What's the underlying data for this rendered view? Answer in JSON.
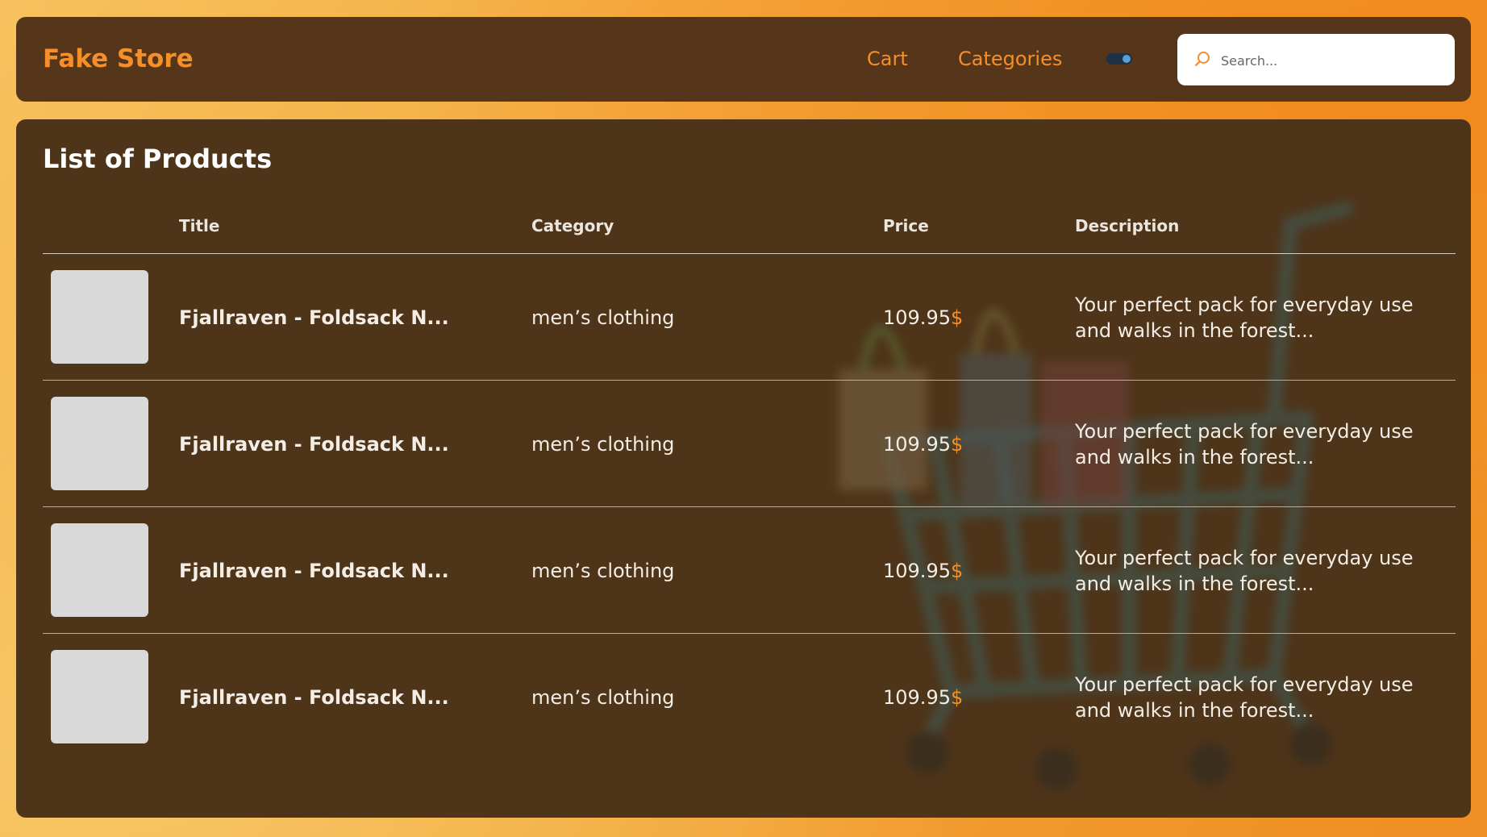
{
  "header": {
    "brand": "Fake Store",
    "nav": {
      "cart": "Cart",
      "categories": "Categories"
    },
    "search": {
      "placeholder": "Search...",
      "value": ""
    }
  },
  "main": {
    "title": "List of Products",
    "columns": {
      "title": "Title",
      "category": "Category",
      "price": "Price",
      "description": "Description"
    },
    "rows": [
      {
        "title": "Fjallraven - Foldsack N...",
        "category": "men’s clothing",
        "price": "109.95",
        "currency": "$",
        "description": "Your perfect pack for everyday use and walks in the forest..."
      },
      {
        "title": "Fjallraven - Foldsack N...",
        "category": "men’s clothing",
        "price": "109.95",
        "currency": "$",
        "description": "Your perfect pack for everyday use and walks in the forest..."
      },
      {
        "title": "Fjallraven - Foldsack N...",
        "category": "men’s clothing",
        "price": "109.95",
        "currency": "$",
        "description": "Your perfect pack for everyday use and walks in the forest..."
      },
      {
        "title": "Fjallraven - Foldsack N...",
        "category": "men’s clothing",
        "price": "109.95",
        "currency": "$",
        "description": "Your perfect pack for everyday use and walks in the forest..."
      }
    ]
  },
  "colors": {
    "accent": "#f58f2a",
    "panel": "#4e3419",
    "navbar": "#55361a",
    "thumbnail": "#d9d9d9"
  },
  "icons": {
    "search": "search-icon",
    "theme_toggle": "toggle-icon"
  }
}
